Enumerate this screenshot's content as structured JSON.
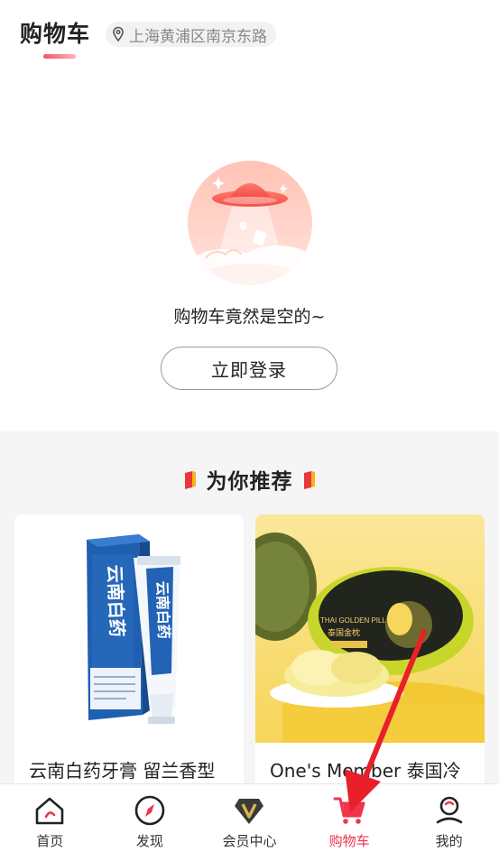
{
  "header": {
    "title": "购物车",
    "location": "上海黄浦区南京东路",
    "location_icon": "location-pin-icon"
  },
  "empty_cart": {
    "message": "购物车竟然是空的~",
    "login_label": "立即登录"
  },
  "recommend": {
    "title": "为你推荐",
    "products": [
      {
        "name": "云南白药牙膏 留兰香型"
      },
      {
        "name": "One's Member 泰国冷"
      }
    ]
  },
  "tabbar": {
    "tabs": [
      {
        "label": "首页",
        "icon": "home-icon"
      },
      {
        "label": "发现",
        "icon": "compass-icon"
      },
      {
        "label": "会员中心",
        "icon": "vip-badge-icon"
      },
      {
        "label": "购物车",
        "icon": "cart-icon",
        "active": true
      },
      {
        "label": "我的",
        "icon": "profile-icon"
      }
    ]
  },
  "colors": {
    "accent": "#f0344e",
    "annotation_arrow": "#e8202a",
    "recommend_bg": "#f5f5f5"
  }
}
